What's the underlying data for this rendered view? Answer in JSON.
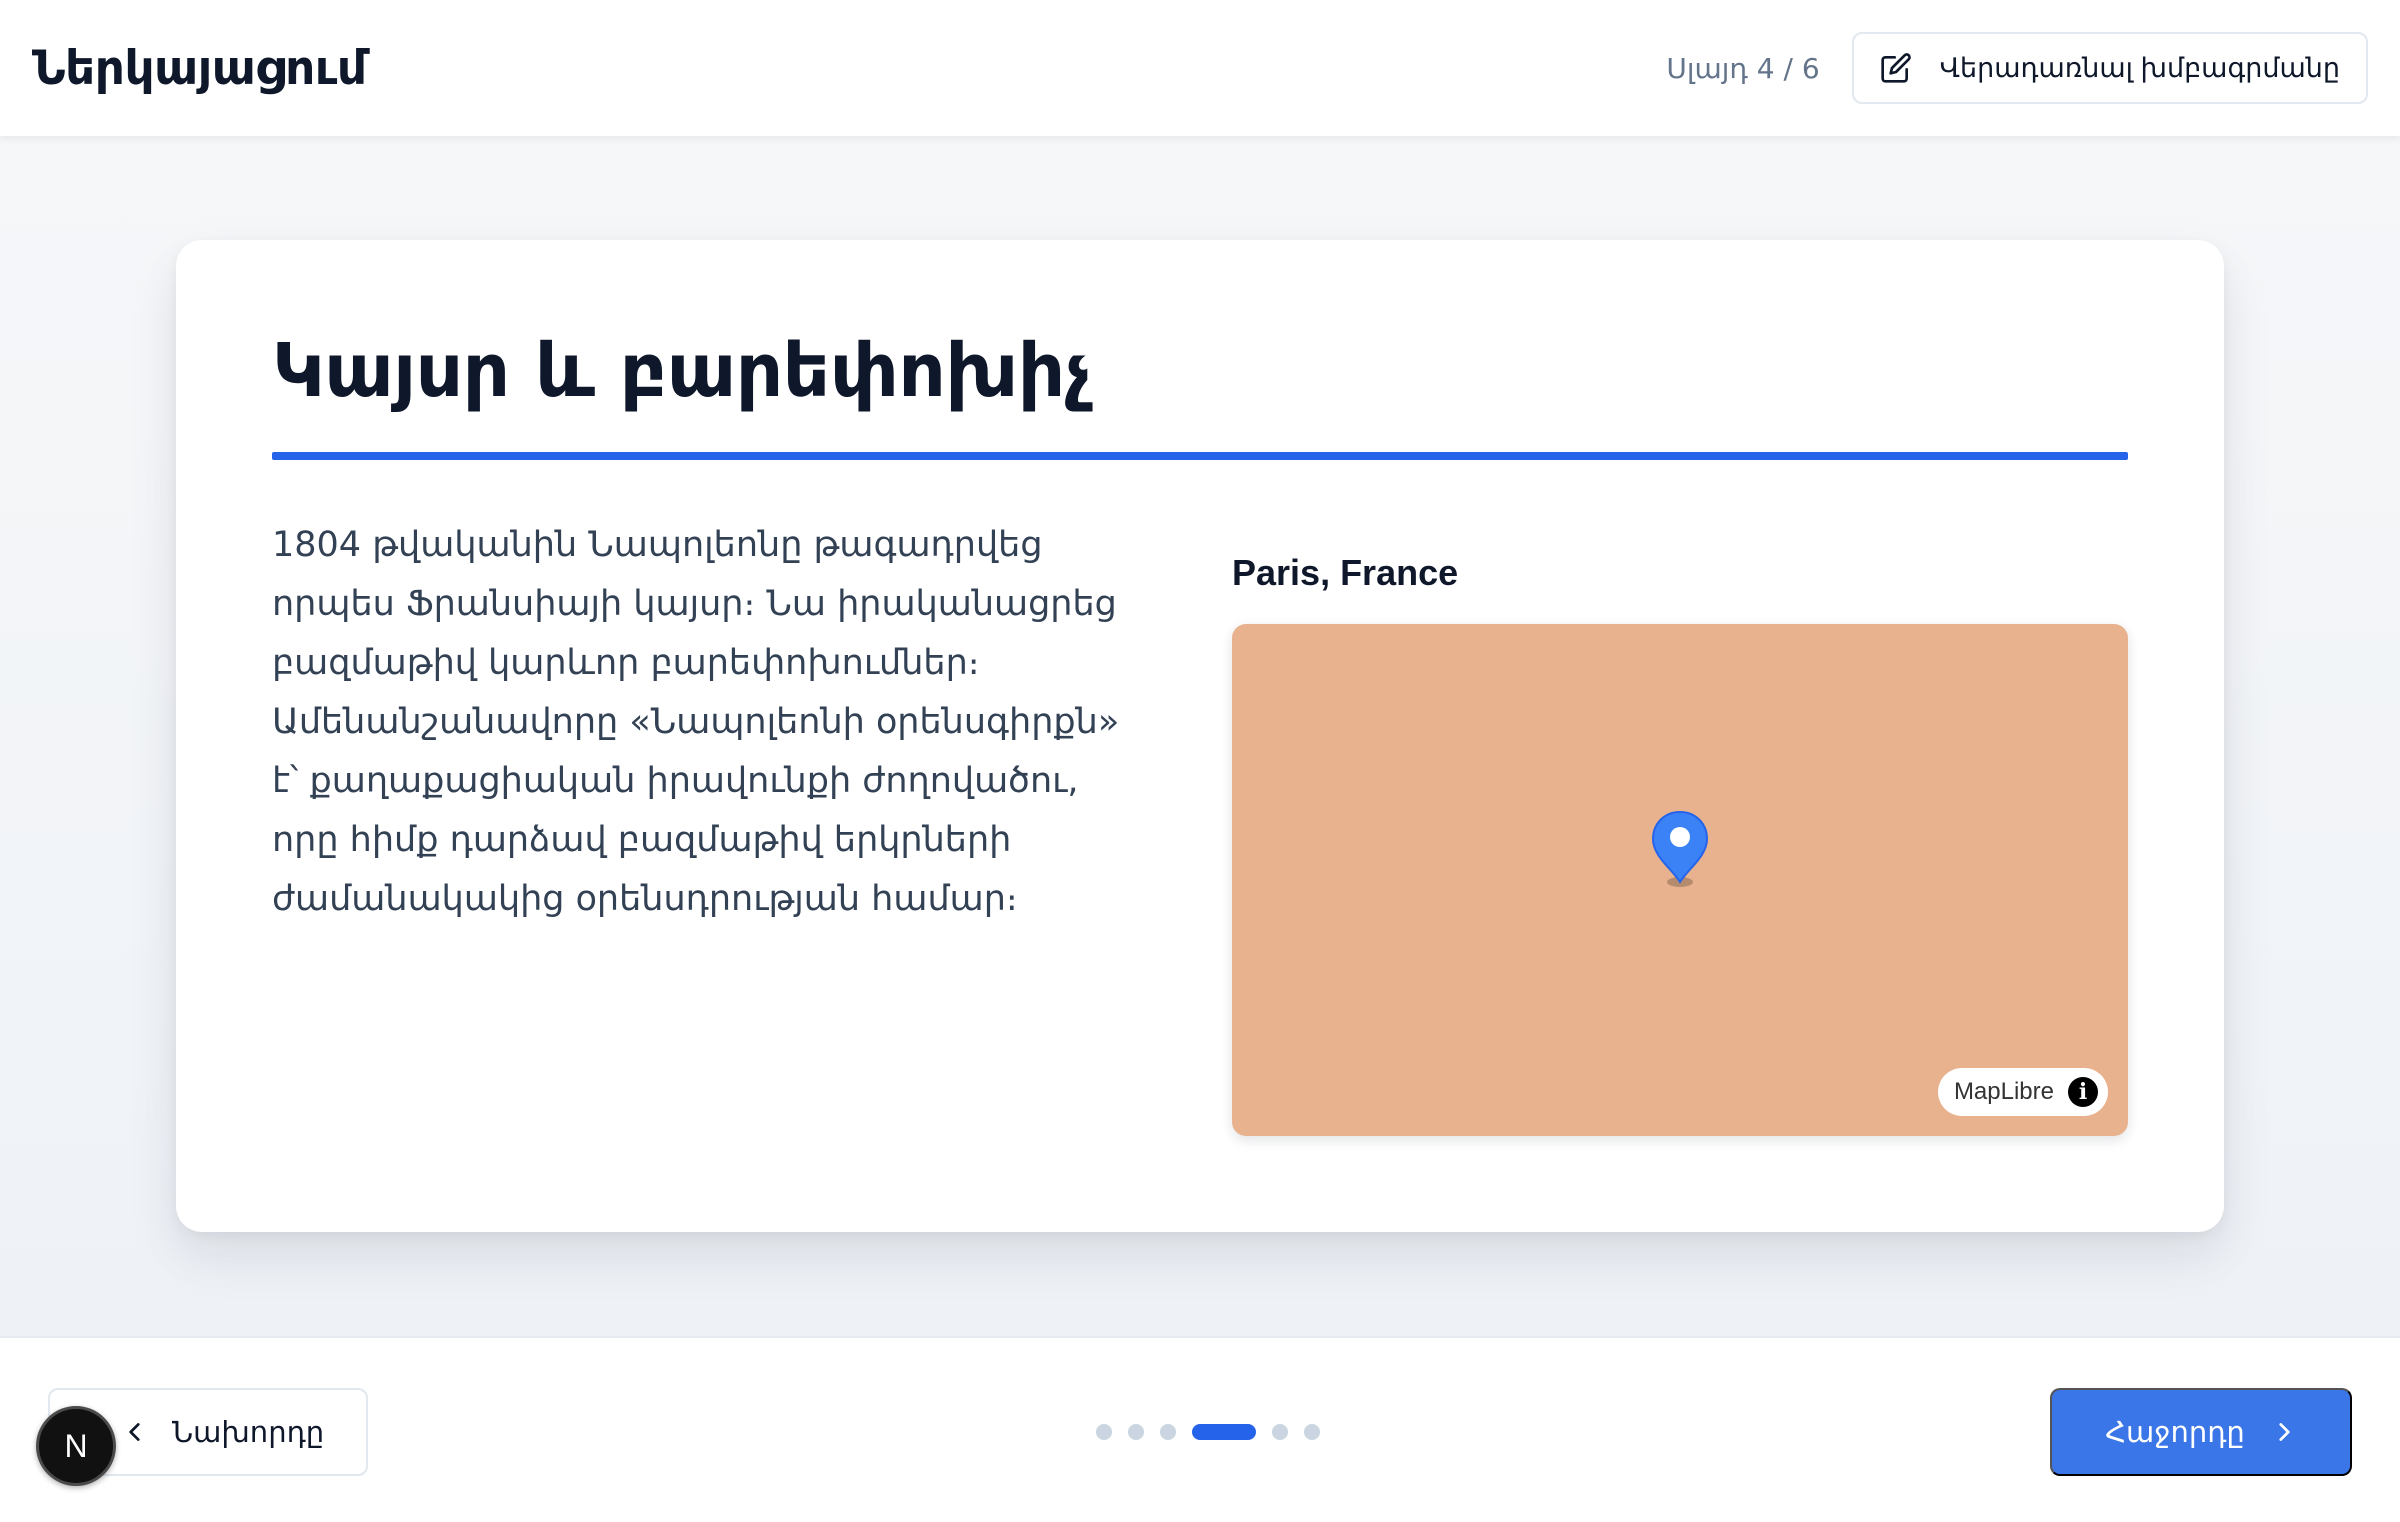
{
  "header": {
    "title": "Ներկայացում",
    "page_indicator": "Սլայդ 4 / 6",
    "edit_button_label": "Վերադառնալ խմբագրմանը"
  },
  "slide": {
    "title": "Կայսր և բարեփոխիչ",
    "body": "1804 թվականին Նապոլեոնը թագադրվեց որպես Ֆրանսիայի կայսր։ Նա իրականացրեց բազմաթիվ կարևոր բարեփոխումներ։ Ամենանշանավորը «Նապոլեոնի օրենսգիրքն» է՝ քաղաքացիական իրավունքի ժողովածու, որը հիմք դարձավ բազմաթիվ երկրների ժամանակակից օրենսդրության համար։",
    "map": {
      "caption": "Paris, France",
      "attribution": "MapLibre",
      "info_icon": "info-icon",
      "marker_icon": "map-pin-icon",
      "fill_color": "#e8b28e"
    }
  },
  "footer": {
    "prev_label": "Նախորդը",
    "next_label": "Հաջորդը",
    "current_page": 4,
    "total_pages": 6
  },
  "badge": {
    "letter": "N"
  },
  "colors": {
    "accent": "#2563eb",
    "next_button": "#3b76e8",
    "inactive_dot": "#cbd5e1"
  }
}
